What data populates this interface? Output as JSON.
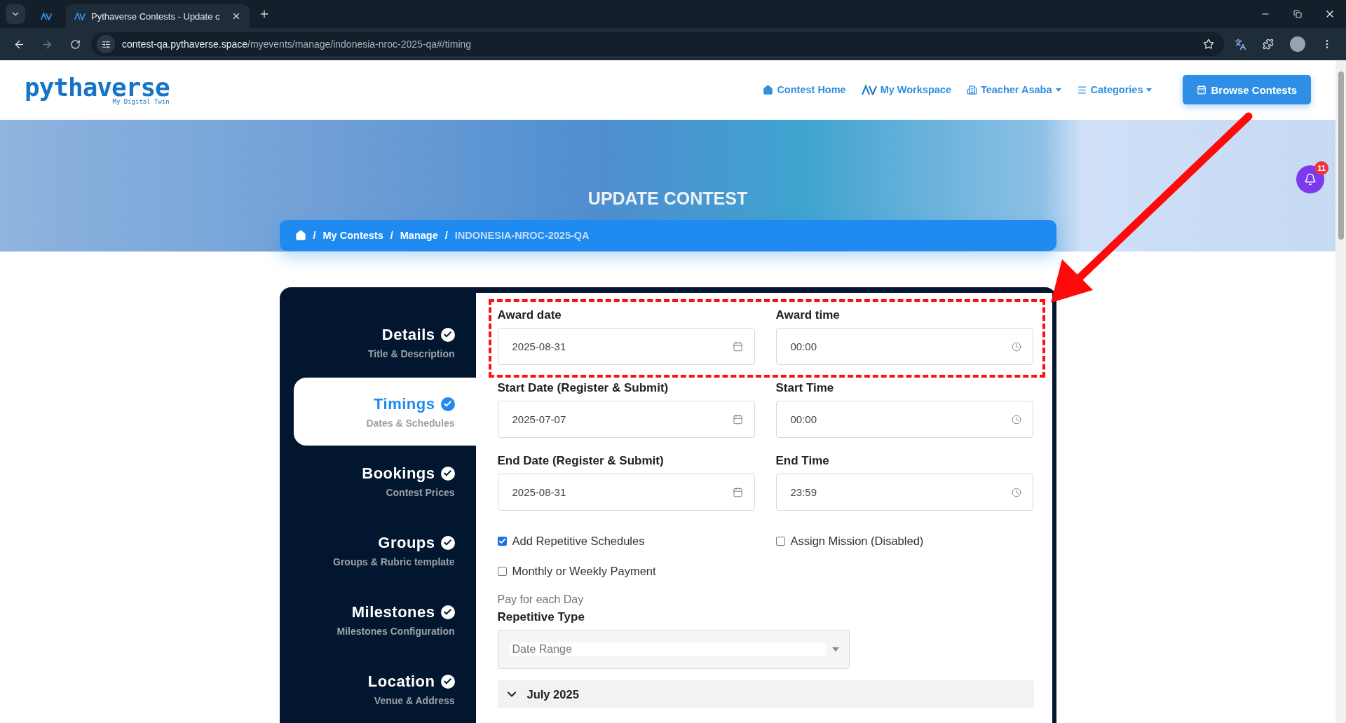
{
  "browser": {
    "tabs": [
      {
        "kind": "pinned",
        "selected": false
      },
      {
        "kind": "page",
        "title": "Pythaverse Contests - Update c",
        "selected": true
      }
    ],
    "url_host": "contest-qa.pythaverse.space",
    "url_path": "/myevents/manage/indonesia-nroc-2025-qa#/timing"
  },
  "header": {
    "logo": {
      "name": "pythaverse",
      "tagline": "My Digital Twin"
    },
    "nav": [
      {
        "label": "Contest Home",
        "kind": "home",
        "dropdown": false
      },
      {
        "label": "My Workspace",
        "kind": "workspace",
        "dropdown": false
      },
      {
        "label": "Teacher Asaba",
        "kind": "user",
        "dropdown": true
      },
      {
        "label": "Categories",
        "kind": "menu",
        "dropdown": true
      }
    ],
    "cta": "Browse Contests"
  },
  "banner": {
    "title": "UPDATE CONTEST",
    "notifications": "11"
  },
  "breadcrumb": [
    {
      "separator": "/",
      "label": "My Contests",
      "current": false
    },
    {
      "separator": "/",
      "label": "Manage",
      "current": false
    },
    {
      "separator": "/",
      "label": "INDONESIA-NROC-2025-QA",
      "current": true
    }
  ],
  "steps": [
    {
      "title": "Details",
      "subtitle": "Title & Description",
      "selected": false,
      "done": true
    },
    {
      "title": "Timings",
      "subtitle": "Dates & Schedules",
      "selected": true,
      "done": true
    },
    {
      "title": "Bookings",
      "subtitle": "Contest Prices",
      "selected": false,
      "done": true
    },
    {
      "title": "Groups",
      "subtitle": "Groups & Rubric template",
      "selected": false,
      "done": true
    },
    {
      "title": "Milestones",
      "subtitle": "Milestones Configuration",
      "selected": false,
      "done": true
    },
    {
      "title": "Location",
      "subtitle": "Venue & Address",
      "selected": false,
      "done": true
    }
  ],
  "fields": [
    {
      "label": "Award date",
      "value": "2025-08-31",
      "kind": "date"
    },
    {
      "label": "Award time",
      "value": "00:00",
      "kind": "time"
    },
    {
      "label": "Start Date (Register & Submit)",
      "value": "2025-07-07",
      "kind": "date"
    },
    {
      "label": "Start Time",
      "value": "00:00",
      "kind": "time"
    },
    {
      "label": "End Date (Register & Submit)",
      "value": "2025-08-31",
      "kind": "date"
    },
    {
      "label": "End Time",
      "value": "23:59",
      "kind": "time"
    }
  ],
  "options": [
    {
      "label": "Add Repetitive Schedules",
      "checked": true
    },
    {
      "label": "Assign Mission (Disabled)",
      "checked": false
    },
    {
      "label": "Monthly or Weekly Payment",
      "checked": false
    }
  ],
  "payment_note": "Pay for each Day",
  "repetitive_type": {
    "label": "Repetitive Type",
    "value": "Date Range"
  },
  "months": [
    {
      "label": "July 2025",
      "expanded": true
    }
  ]
}
